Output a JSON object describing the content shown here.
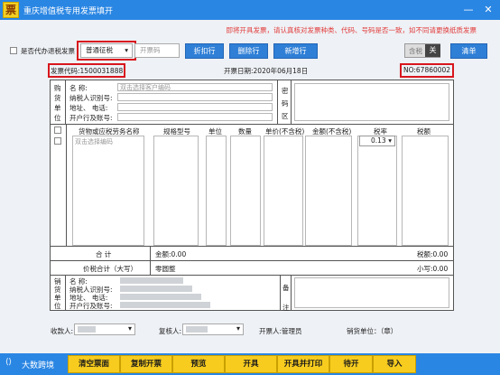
{
  "window": {
    "logo_char": "票",
    "title": "重庆增值税专用发票填开",
    "minimize": "—",
    "close": "✕"
  },
  "notice": "即将开具发票，请认真核对发票种类、代码、号码是否一致，如不同请更换纸质发票",
  "toolbar": {
    "proxy_label": "是否代办退税发票",
    "levy_select": "普通征税",
    "code_placeholder": "开票码",
    "discount_btn": "折扣行",
    "delete_btn": "删除行",
    "add_btn": "新增行",
    "tax_incl_label": "含税",
    "tax_toggle": "关",
    "clear_btn": "清单"
  },
  "header": {
    "invoice_code": "发票代码:1500031888",
    "date": "开票日期:2020年06月18日",
    "invoice_no": "NO:67860002"
  },
  "buyer": {
    "side_label": [
      "购",
      "货",
      "单",
      "位"
    ],
    "name_label": "名      称:",
    "name_placeholder": "双击选择客户编码",
    "taxid_label": "纳税人识别号:",
    "addr_label": "地址、  电话:",
    "bank_label": "开户行及账号:",
    "cipher_label": [
      "密",
      "码",
      "区"
    ]
  },
  "items": {
    "headers": [
      "货物或应税劳务名称",
      "规格型号",
      "单位",
      "数量",
      "单价(不含税)",
      "金额(不含税)",
      "税率",
      "税额"
    ],
    "item_placeholder": "双击选择编码",
    "tax_rate": "0.13"
  },
  "totals": {
    "total_label": "合    计",
    "amount": "金额:0.00",
    "tax": "税额:0.00",
    "sum_label": "价税合计（大写）",
    "sum_words": "零圆整",
    "sum_small": "小写:0.00"
  },
  "seller": {
    "side_label": [
      "销",
      "货",
      "单",
      "位"
    ],
    "name_label": "名      称:",
    "taxid_label": "纳税人识别号:",
    "addr_label": "地址、  电话:",
    "bank_label": "开户行及账号:",
    "remark_label": [
      "备",
      "注"
    ]
  },
  "footer": {
    "payee": "收款人:",
    "reviewer": "复核人:",
    "issuer": "开票人:管理员",
    "seller_seal": "销货单位：（章）"
  },
  "bottom": {
    "brand": "大数跨境",
    "buttons": [
      "清空票面",
      "复制开票",
      "预览",
      "开具",
      "开具并打印",
      "待开",
      "导入"
    ]
  }
}
